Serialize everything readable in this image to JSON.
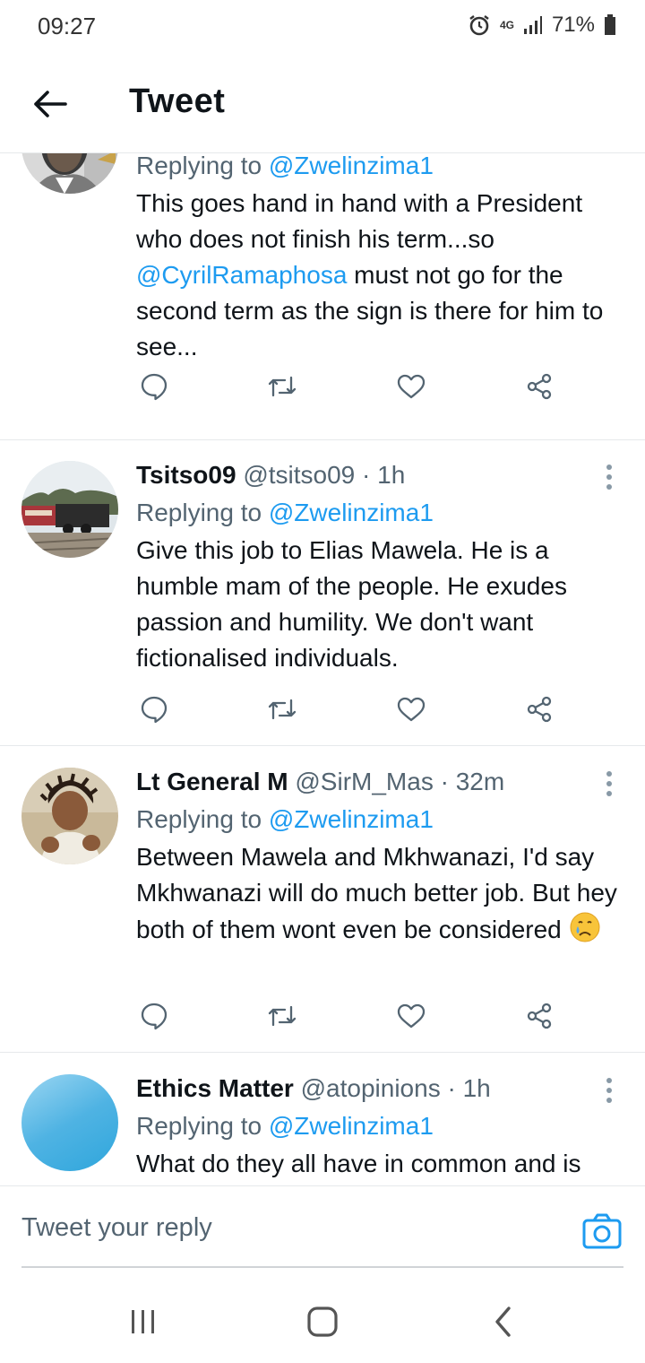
{
  "status_bar": {
    "time": "09:27",
    "battery": "71%",
    "network": "4G"
  },
  "header": {
    "title": "Tweet"
  },
  "tweets": [
    {
      "name": "",
      "handle": "",
      "time": "",
      "replying_label": "Replying to",
      "replying_to": "@Zwelinzima1",
      "text_parts": {
        "a": "This goes hand in hand with a President who does not finish his term...so ",
        "mention": "@CyrilRamaphosa",
        "b": " must not go for the second term as the sign is there for him to see..."
      }
    },
    {
      "name": "Tsitso09",
      "handle": "@tsitso09",
      "time": "1h",
      "replying_label": "Replying to",
      "replying_to": "@Zwelinzima1",
      "text": "Give this job to Elias Mawela. He is a humble mam of the people. He exudes passion and humility. We don't want fictionalised individuals."
    },
    {
      "name": "Lt General M",
      "handle": "@SirM_Mas",
      "time": "32m",
      "replying_label": "Replying to",
      "replying_to": "@Zwelinzima1",
      "text": "Between Mawela and Mkhwanazi, I'd say Mkhwanazi will do much better job. But hey both of them wont even be considered",
      "emoji": "crying-face"
    },
    {
      "name": "Ethics Matter",
      "handle": "@atopinions",
      "time": "1h",
      "replying_label": "Replying to",
      "replying_to": "@Zwelinzima1",
      "text": "What do they all have in common and is"
    }
  ],
  "reply_bar": {
    "placeholder": "Tweet your reply"
  },
  "icons": {
    "back": "arrow-left-icon",
    "reply": "reply-icon",
    "retweet": "retweet-icon",
    "like": "heart-icon",
    "share": "share-icon",
    "more": "more-vertical-icon",
    "camera": "camera-icon"
  },
  "colors": {
    "accent": "#1d9bf0",
    "text": "#0f1419",
    "muted": "#536471",
    "divider": "#e6e9eb"
  }
}
